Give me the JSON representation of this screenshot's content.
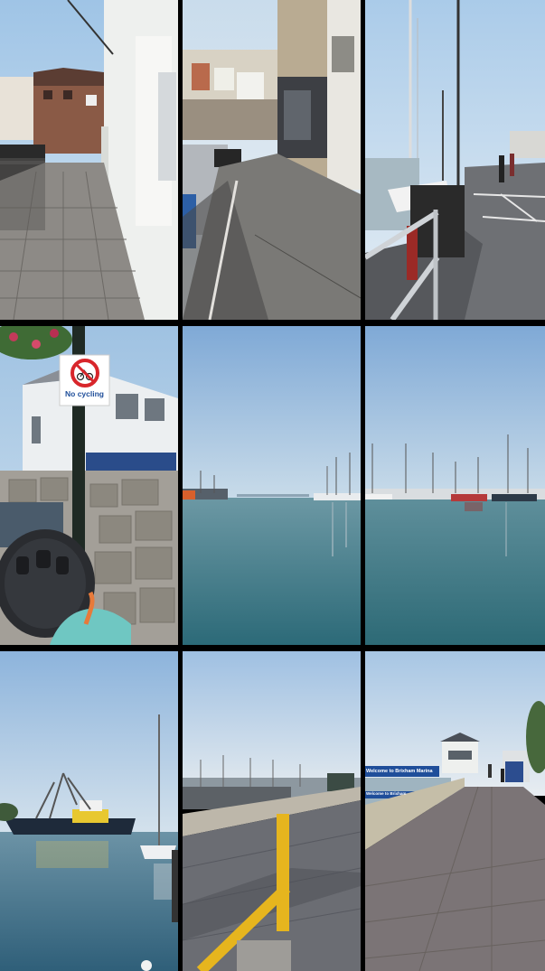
{
  "collage": {
    "tiles": [
      {
        "id": "street-walkway"
      },
      {
        "id": "harbour-street"
      },
      {
        "id": "marina-railing"
      },
      {
        "id": "no-cycling-sign",
        "sign_text": "No cycling"
      },
      {
        "id": "calm-harbour-wide"
      },
      {
        "id": "marina-boats"
      },
      {
        "id": "fishing-trawler"
      },
      {
        "id": "promenade-yellow-rail"
      },
      {
        "id": "marina-walkway",
        "sign_text": "Welcome to Brixham Marina",
        "sign_text_2": "Welcome to Brixham"
      }
    ],
    "colors": {
      "sky": "#a9c9e8",
      "water": "#3f7a86",
      "paving": "#6b6d73",
      "yellow_rail": "#e6b51e",
      "sign_red": "#d8262b",
      "sign_blue": "#1f4e9a"
    }
  }
}
